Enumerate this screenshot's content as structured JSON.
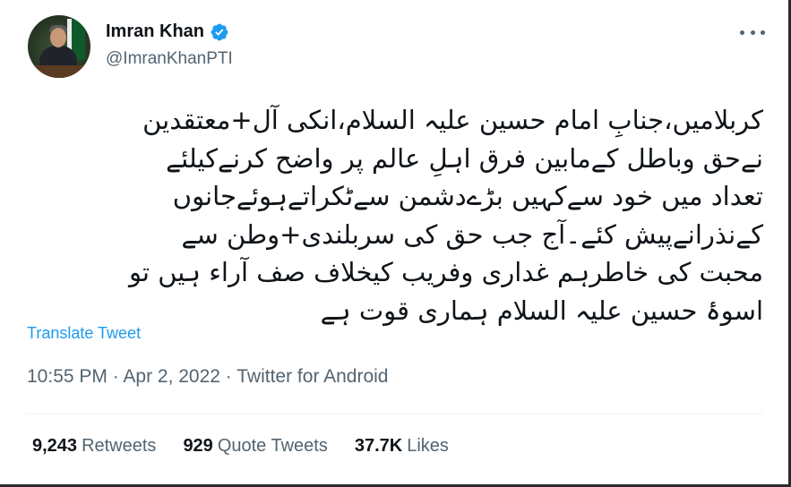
{
  "author": {
    "name": "Imran Khan",
    "handle": "@ImranKhanPTI",
    "verified": true
  },
  "tweet": {
    "lines": [
      "کربلامیں،جنابِ امام حسین علیہ السلام،انکی آل+معتقدین",
      "نےحق وباطل کےمابین فرق اہلِ عالم پر واضح کرنےکیلئے",
      "تعداد میں خود سےکہیں بڑےدشمن سےٹکراتےہوئےجانوں",
      "کےنذرانےپیش کئے۔آج جب حق کی سربلندی+وطن سے",
      "محبت کی خاطرہم غداری وفریب کیخلاف صف آراء ہیں تو",
      "اسوۂ حسین علیہ السلام ہماری قوت ہے"
    ],
    "translate_label": "Translate Tweet",
    "timestamp": "10:55 PM · Apr 2, 2022 · Twitter for Android"
  },
  "stats": {
    "retweets_count": "9,243",
    "retweets_label": "Retweets",
    "quotes_count": "929",
    "quotes_label": "Quote Tweets",
    "likes_count": "37.7K",
    "likes_label": "Likes"
  },
  "colors": {
    "accent": "#1d9bf0",
    "secondary_text": "#536471",
    "primary_text": "#0f1419",
    "divider": "#eff3f4"
  },
  "icons": [
    "verified-badge-icon",
    "more-options-icon"
  ]
}
